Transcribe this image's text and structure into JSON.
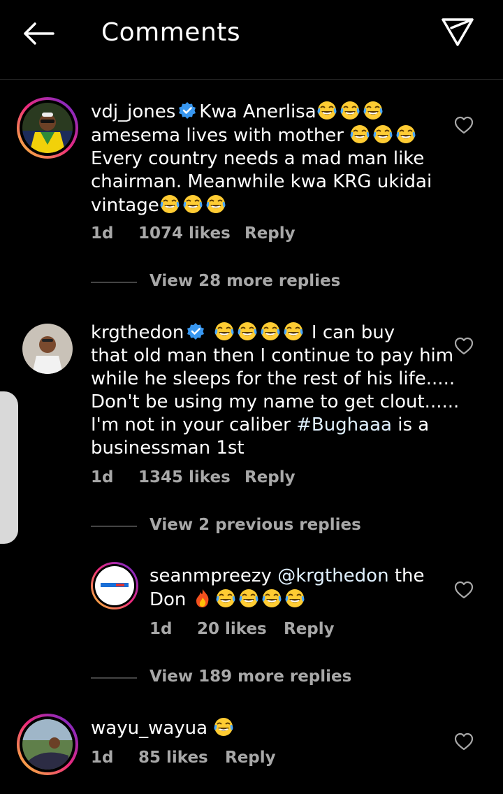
{
  "header": {
    "title": "Comments"
  },
  "comments": [
    {
      "username": "vdj_jones",
      "verified": true,
      "text_lines": [
        [
          "Kwa Anerlisa",
          "emoji",
          "emoji",
          "emoji"
        ],
        [
          "amesema lives with  mother ",
          "emoji",
          "emoji",
          "emoji"
        ],
        [
          "Every country needs a mad man like"
        ],
        [
          "chairman. Meanwhile kwa KRG ukidai"
        ],
        [
          "vintage",
          "emoji",
          "emoji",
          "emoji"
        ]
      ],
      "line1_text": "Kwa Anerlisa",
      "line2_text": "amesema lives with  mother ",
      "line3_text": "Every country needs a mad man like",
      "line4_text": "chairman. Meanwhile kwa KRG ukidai",
      "line5_text": "vintage",
      "time": "1d",
      "likes": "1074 likes",
      "reply": "Reply",
      "view_replies": "View 28 more replies"
    },
    {
      "username": "krgthedon",
      "verified": true,
      "line1_text": "I can buy",
      "line2_text": "that old man then I continue to pay him",
      "line3_text": "while he sleeps for the rest of his life.....",
      "line4_text": "Don't be using my name to get clout......",
      "line5_pre": "I'm not in your caliber ",
      "hashtag": "#Bughaaa",
      "line5_post": " is a",
      "line6_text": "businessman 1st",
      "time": "1d",
      "likes": "1345 likes",
      "reply": "Reply",
      "view_replies": "View 2 previous replies"
    },
    {
      "username": "seanmpreezy",
      "verified": false,
      "mention": "@krgthedon",
      "line1_post": " the",
      "line2_text": "Don",
      "time": "1d",
      "likes": "20 likes",
      "reply": "Reply",
      "view_replies": "View 189 more replies"
    },
    {
      "username": "wayu_wayua",
      "verified": false,
      "time": "1d",
      "likes": "85 likes",
      "reply": "Reply"
    }
  ],
  "icons": {
    "back": "arrow-left-icon",
    "send": "paper-plane-icon",
    "like": "heart-outline-icon",
    "verified": "verified-badge-icon",
    "emoji": "tears-of-joy-emoji",
    "fire": "fire-emoji"
  },
  "colors": {
    "background": "#000000",
    "verified": "#3897f0",
    "meta": "#a8a8a8"
  }
}
